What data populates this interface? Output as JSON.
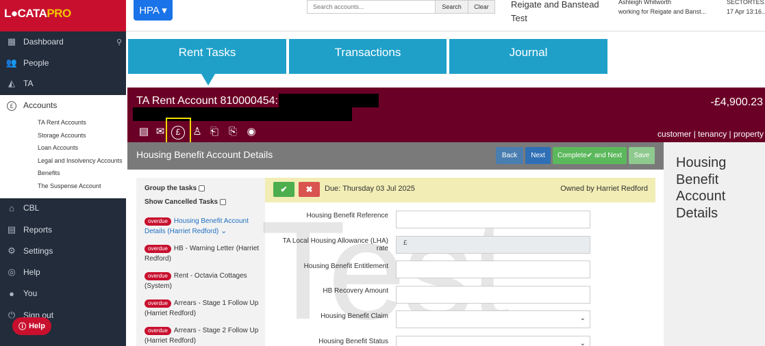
{
  "app": {
    "logo_main": "L●CATA",
    "logo_pro": "PRO",
    "hpa_label": "HPA ▾"
  },
  "topbar": {
    "search_placeholder": "Search accounts...",
    "search_label": "Search",
    "clear_label": "Clear",
    "council": "Reigate and Banstead Test",
    "user_name": "Ashleigh Whitworth",
    "user_org": "working for Reigate and Banst...",
    "sect_code": "SECTORTES...",
    "sect_time": "17 Apr 13:16..."
  },
  "sidebar": {
    "items": [
      {
        "icon": "grid-icon",
        "glyph": "▦",
        "label": "Dashboard"
      },
      {
        "icon": "people-icon",
        "glyph": "👥",
        "label": "People"
      },
      {
        "icon": "road-icon",
        "glyph": "◭",
        "label": "TA"
      },
      {
        "icon": "pound-circle-icon",
        "glyph": "£",
        "label": "Accounts"
      },
      {
        "icon": "home-icon",
        "glyph": "⌂",
        "label": "CBL"
      },
      {
        "icon": "document-icon",
        "glyph": "▤",
        "label": "Reports"
      },
      {
        "icon": "gear-icon",
        "glyph": "⚙",
        "label": "Settings"
      },
      {
        "icon": "lifebuoy-icon",
        "glyph": "◎",
        "label": "Help"
      },
      {
        "icon": "user-icon",
        "glyph": "●",
        "label": "You"
      },
      {
        "icon": "power-icon",
        "glyph": "⏻",
        "label": "Sign out"
      }
    ],
    "subitems": [
      "TA Rent Accounts",
      "Storage Accounts",
      "Loan Accounts",
      "Legal and Insolvency Accounts",
      "Benefits",
      "The Suspense Account"
    ],
    "help_button": "Help"
  },
  "tabs": [
    "Rent Tasks",
    "Transactions",
    "Journal"
  ],
  "account": {
    "title": "TA Rent Account 810000454:",
    "balance": "-£4,900.23",
    "links": "customer | tenancy | property"
  },
  "section": {
    "title": "Housing Benefit Account Details",
    "back": "Back",
    "next": "Next",
    "complete_next": "Complete✔ and Next",
    "save": "Save"
  },
  "right_panel": {
    "title": "Housing Benefit Account Details"
  },
  "tasks": {
    "group_label": "Group the tasks",
    "cancelled_label": "Show Cancelled Tasks",
    "badge": "overdue",
    "items": [
      "Housing Benefit Account Details (Harriet Redford)",
      "HB - Warning Letter (Harriet Redford)",
      "Rent - Octavia Cottages (System)",
      "Arrears - Stage 1 Follow Up (Harriet Redford)",
      "Arrears - Stage 2 Follow Up (Harriet Redford)"
    ]
  },
  "due": {
    "text": "Due: Thursday 03 Jul 2025",
    "owner": "Owned by Harriet Redford"
  },
  "watermark": "Test",
  "form": {
    "fields": [
      {
        "label": "Housing Benefit Reference",
        "value": ""
      },
      {
        "label": "TA Local Housing Allowance (LHA) rate",
        "value": "£"
      },
      {
        "label": "Housing Benefit Entitlement",
        "value": ""
      },
      {
        "label": "HB Recovery Amount",
        "value": ""
      },
      {
        "label": "Housing Benefit Claim",
        "value": ""
      },
      {
        "label": "Housing Benefit Status",
        "value": ""
      }
    ]
  },
  "colors": {
    "brand": "#c8102e",
    "tab": "#1ea0c9",
    "banner": "#6b0026",
    "next": "#2f6fb5",
    "complete": "#5cb85c"
  }
}
